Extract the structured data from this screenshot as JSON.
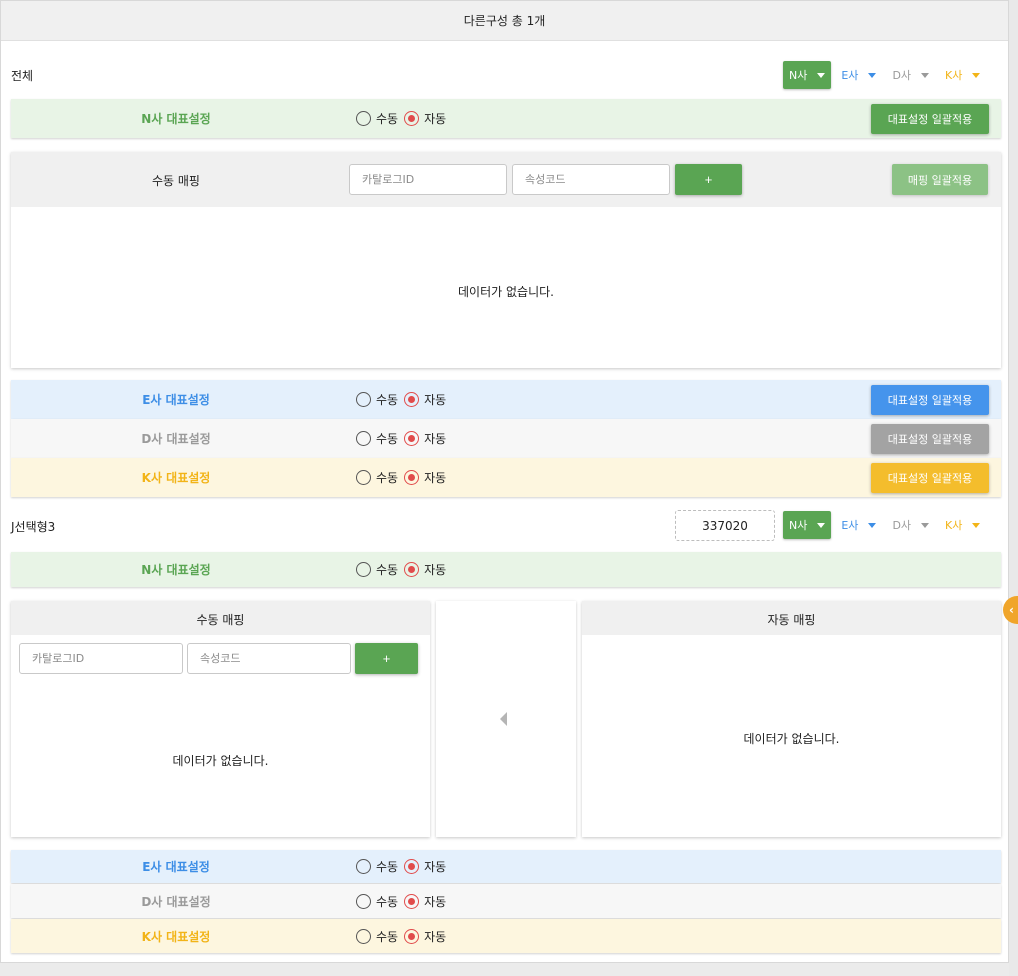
{
  "header": {
    "title": "다른구성 총 1개"
  },
  "vendors": {
    "n_label": "N사",
    "e_label": "E사",
    "d_label": "D사",
    "k_label": "K사"
  },
  "radio": {
    "manual": "수동",
    "auto": "자동"
  },
  "section_all": {
    "title": "전체",
    "rows": {
      "n": {
        "label": "N사 대표설정",
        "button": "대표설정 일괄적용",
        "selected": "자동"
      },
      "e": {
        "label": "E사 대표설정",
        "button": "대표설정 일괄적용",
        "selected": "자동"
      },
      "d": {
        "label": "D사 대표설정",
        "button": "대표설정 일괄적용",
        "selected": "자동"
      },
      "k": {
        "label": "K사 대표설정",
        "button": "대표설정 일괄적용",
        "selected": "자동"
      }
    },
    "manual_mapping": {
      "title": "수동 매핑",
      "catalog_placeholder": "카탈로그ID",
      "attr_placeholder": "속성코드",
      "add_label": "+",
      "apply_label": "매핑 일괄적용",
      "empty_text": "데이터가 없습니다."
    }
  },
  "section_option": {
    "title": "J선택형3",
    "code": "337020",
    "rows": {
      "n": {
        "label": "N사 대표설정",
        "selected": "자동"
      },
      "e": {
        "label": "E사 대표설정",
        "selected": "자동"
      },
      "d": {
        "label": "D사 대표설정",
        "selected": "자동"
      },
      "k": {
        "label": "K사 대표설정",
        "selected": "자동"
      }
    },
    "manual_mapping": {
      "title": "수동 매핑",
      "catalog_placeholder": "카탈로그ID",
      "attr_placeholder": "속성코드",
      "add_label": "+",
      "empty_text": "데이터가 없습니다."
    },
    "auto_mapping": {
      "title": "자동 매핑",
      "empty_text": "데이터가 없습니다."
    }
  },
  "colors": {
    "n": "#5aa553",
    "e": "#3d8ee6",
    "d": "#9a9a9a",
    "k": "#f2b418",
    "radio_checked": "#e14b4b"
  },
  "icons": {
    "dropdown": "caret-down-icon",
    "transfer": "arrow-left-icon",
    "panel_toggle": "chevron-left-icon"
  }
}
